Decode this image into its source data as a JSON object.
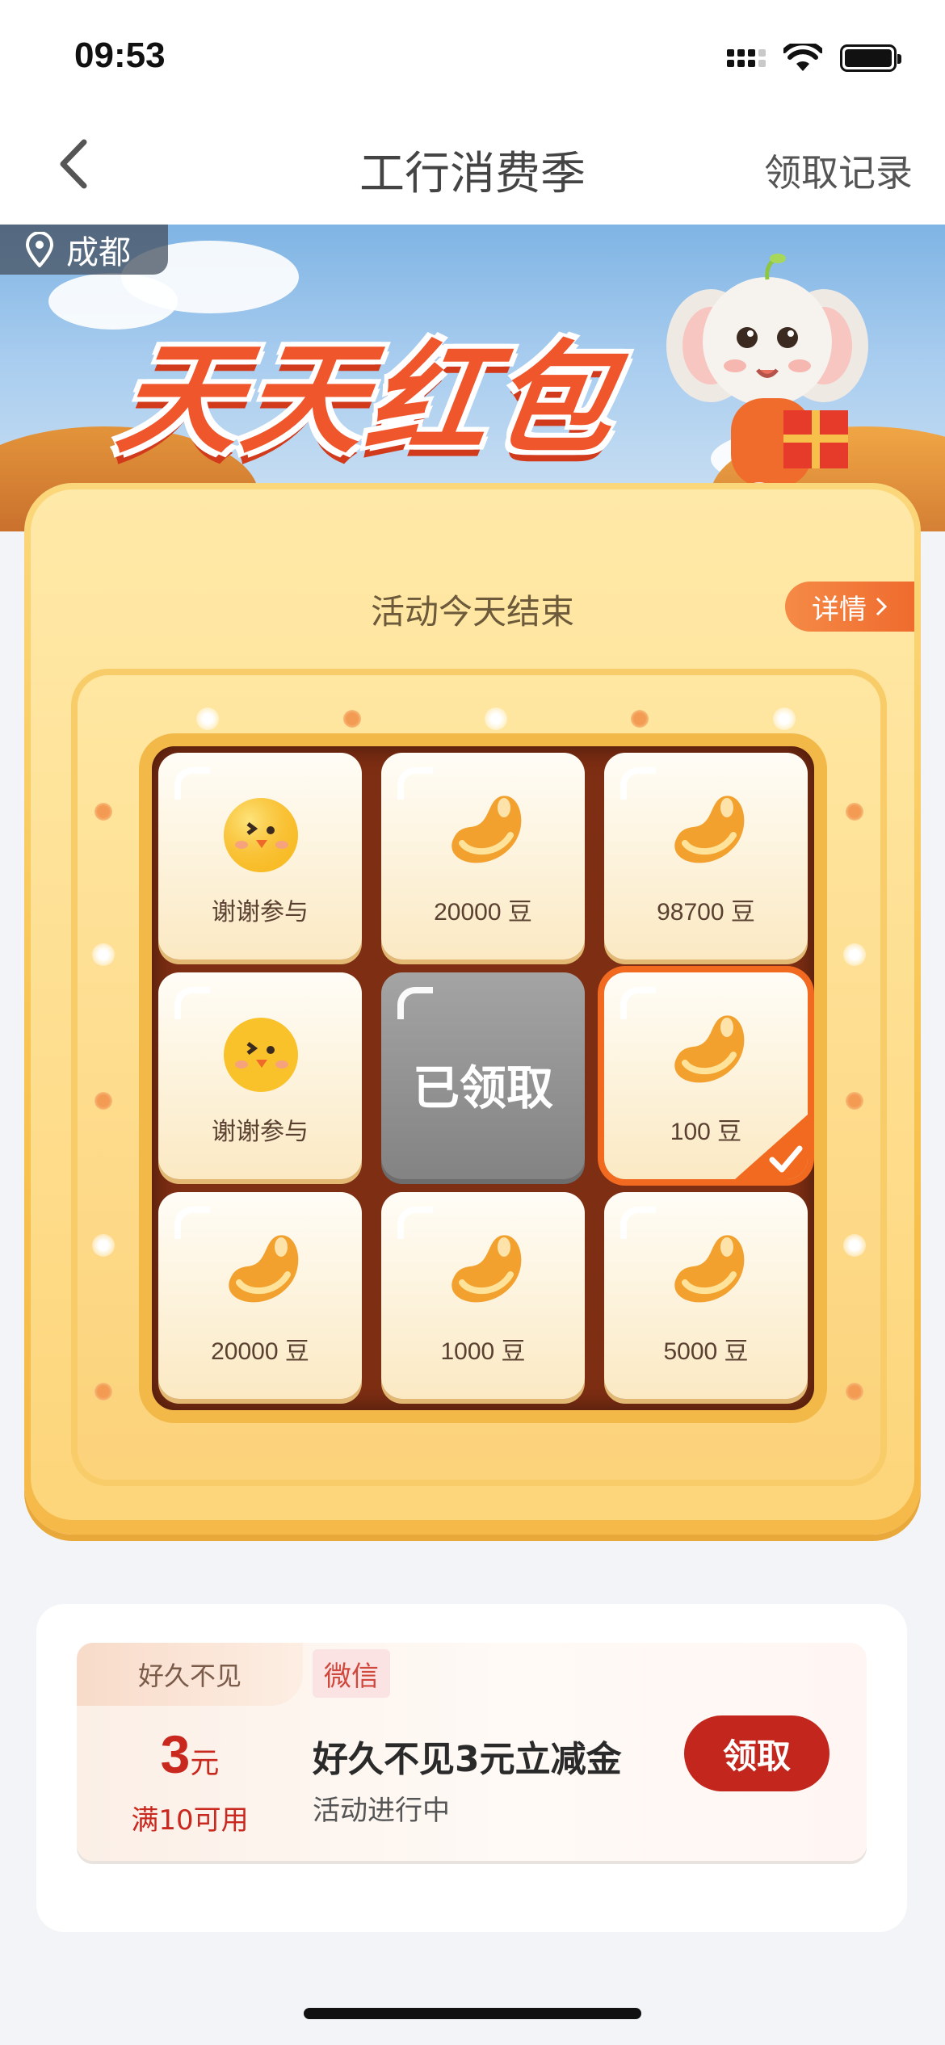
{
  "status_bar": {
    "time": "09:53"
  },
  "nav": {
    "title": "工行消费季",
    "record_label": "领取记录"
  },
  "banner": {
    "location": "成都",
    "title": "天天红包"
  },
  "game": {
    "status_text": "活动今天结束",
    "detail_label": "详情",
    "prizes": [
      {
        "label": "谢谢参与",
        "icon": "chick-icon"
      },
      {
        "label": "20000 豆",
        "icon": "bean-icon"
      },
      {
        "label": "98700 豆",
        "icon": "bean-icon"
      },
      {
        "label": "谢谢参与",
        "icon": "chick-icon"
      },
      {
        "label": "已领取",
        "icon": "none",
        "state": "claimed"
      },
      {
        "label": "100 豆",
        "icon": "bean-icon",
        "state": "selected"
      },
      {
        "label": "20000 豆",
        "icon": "bean-icon"
      },
      {
        "label": "1000 豆",
        "icon": "bean-icon"
      },
      {
        "label": "5000 豆",
        "icon": "bean-icon"
      }
    ]
  },
  "coupon": {
    "tag": "好久不见",
    "amount": "3",
    "unit": "元",
    "condition": "满10可用",
    "source": "微信",
    "title": "好久不见3元立减金",
    "status": "活动进行中",
    "claim_label": "领取"
  },
  "colors": {
    "accent_red": "#c3261d",
    "accent_orange": "#f26a1f",
    "gold": "#f8c350"
  }
}
